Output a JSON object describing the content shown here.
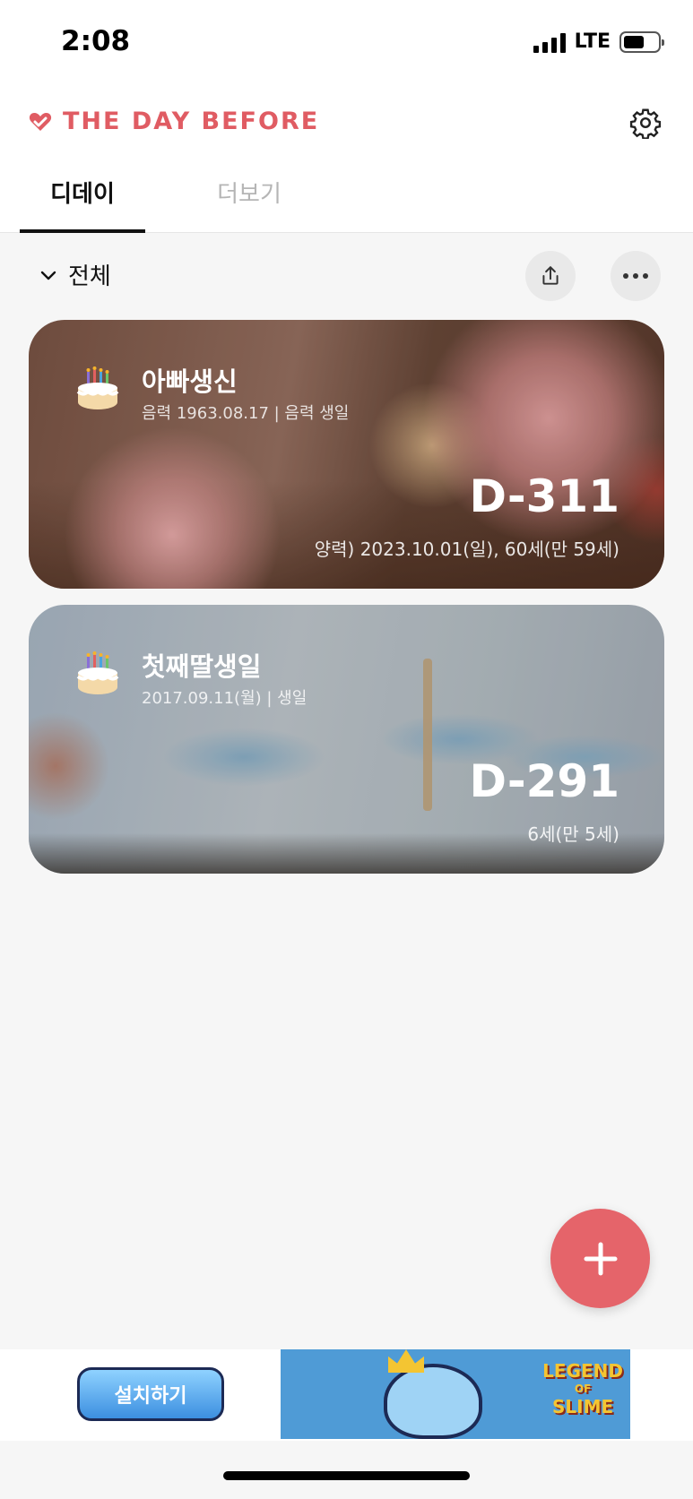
{
  "status_bar": {
    "time": "2:08",
    "network": "LTE"
  },
  "header": {
    "brand": "THE DAY BEFORE",
    "icons": [
      "heart-icon",
      "gear-icon"
    ]
  },
  "tabs": [
    {
      "label": "디데이",
      "active": true
    },
    {
      "label": "더보기",
      "active": false
    }
  ],
  "toolbar": {
    "filter_label": "전체",
    "icons": [
      "chevron-down-icon",
      "share-icon",
      "more-icon"
    ]
  },
  "cards": [
    {
      "title": "아빠생신",
      "subtitle": "음력 1963.08.17  |  음력 생일",
      "dday": "D-311",
      "detail": "양력) 2023.10.01(일), 60세(만 59세)"
    },
    {
      "title": "첫째딸생일",
      "subtitle": "2017.09.11(월)  |  생일",
      "dday": "D-291",
      "detail": "6세(만 5세)"
    }
  ],
  "fab": {
    "icon": "plus-icon"
  },
  "ad": {
    "install_label": "설치하기",
    "logo_line1": "LEGEND",
    "logo_line2": "OF",
    "logo_line3": "SLIME"
  },
  "colors": {
    "brand": "#e05c63",
    "fab": "#e5646a",
    "background": "#f6f6f6"
  }
}
